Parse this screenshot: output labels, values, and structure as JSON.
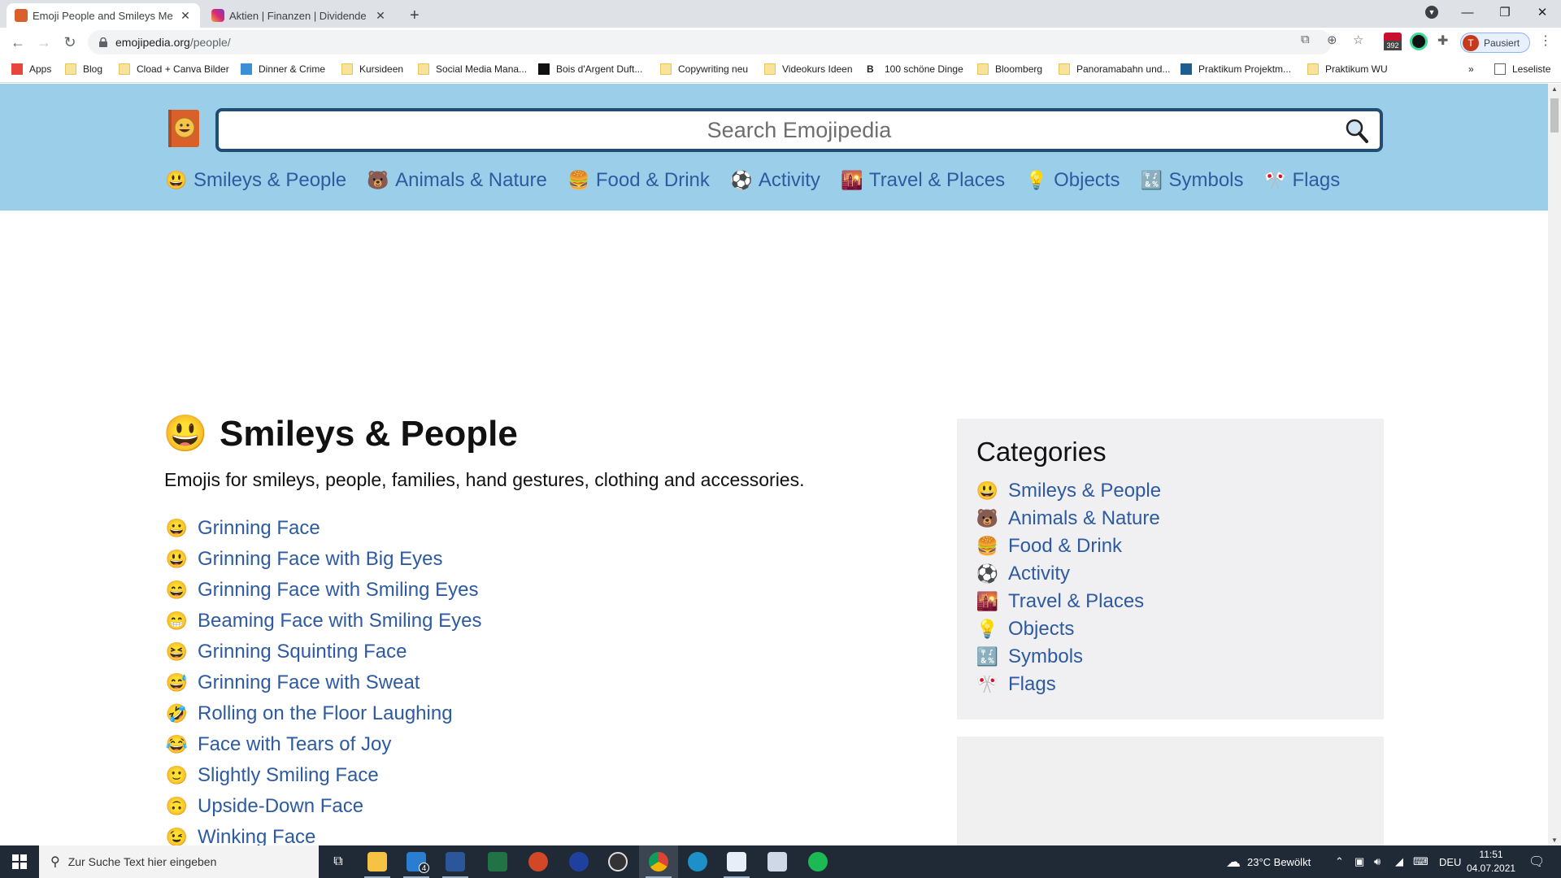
{
  "browser": {
    "tabs": [
      {
        "title": "Emoji People and Smileys Me",
        "active": true
      },
      {
        "title": "Aktien | Finanzen | Dividende (@",
        "active": false
      }
    ],
    "new_tab_label": "+",
    "url_host": "emojipedia.org",
    "url_path": "/people/",
    "profile_initial": "T",
    "profile_status": "Pausiert",
    "extension_badge": "392",
    "bookmarks": [
      {
        "label": "Apps",
        "icon": "apps-grid-icon"
      },
      {
        "label": "Blog",
        "icon": "folder-icon"
      },
      {
        "label": "Cload + Canva Bilder",
        "icon": "folder-icon"
      },
      {
        "label": "Dinner & Crime",
        "icon": "id-site-icon"
      },
      {
        "label": "Kursideen",
        "icon": "folder-icon"
      },
      {
        "label": "Social Media Mana...",
        "icon": "folder-icon"
      },
      {
        "label": "Bois d'Argent Duft...",
        "icon": "dior-site-icon"
      },
      {
        "label": "Copywriting neu",
        "icon": "folder-icon"
      },
      {
        "label": "Videokurs Ideen",
        "icon": "folder-icon"
      },
      {
        "label": "100 schöne Dinge",
        "icon": "b-site-icon"
      },
      {
        "label": "Bloomberg",
        "icon": "folder-icon"
      },
      {
        "label": "Panoramabahn und...",
        "icon": "folder-icon"
      },
      {
        "label": "Praktikum Projektm...",
        "icon": "j-site-icon"
      },
      {
        "label": "Praktikum WU",
        "icon": "folder-icon"
      }
    ],
    "bookmarks_overflow": "»",
    "reading_list": "Leseliste"
  },
  "site": {
    "search_placeholder": "Search Emojipedia",
    "nav": [
      {
        "label": "Smileys & People",
        "emoji": "😃"
      },
      {
        "label": "Animals & Nature",
        "emoji": "🐻"
      },
      {
        "label": "Food & Drink",
        "emoji": "🍔"
      },
      {
        "label": "Activity",
        "emoji": "⚽"
      },
      {
        "label": "Travel & Places",
        "emoji": "🌇"
      },
      {
        "label": "Objects",
        "emoji": "💡"
      },
      {
        "label": "Symbols",
        "emoji": "🔣"
      },
      {
        "label": "Flags",
        "emoji": "🎌"
      }
    ]
  },
  "main": {
    "title": "Smileys & People",
    "title_emoji": "😃",
    "intro": "Emojis for smileys, people, families, hand gestures, clothing and accessories.",
    "emojis": [
      {
        "name": "Grinning Face",
        "emoji": "😀"
      },
      {
        "name": "Grinning Face with Big Eyes",
        "emoji": "😃"
      },
      {
        "name": "Grinning Face with Smiling Eyes",
        "emoji": "😄"
      },
      {
        "name": "Beaming Face with Smiling Eyes",
        "emoji": "😁"
      },
      {
        "name": "Grinning Squinting Face",
        "emoji": "😆"
      },
      {
        "name": "Grinning Face with Sweat",
        "emoji": "😅"
      },
      {
        "name": "Rolling on the Floor Laughing",
        "emoji": "🤣"
      },
      {
        "name": "Face with Tears of Joy",
        "emoji": "😂"
      },
      {
        "name": "Slightly Smiling Face",
        "emoji": "🙂"
      },
      {
        "name": "Upside-Down Face",
        "emoji": "🙃"
      },
      {
        "name": "Winking Face",
        "emoji": "😉"
      }
    ]
  },
  "sidebar": {
    "title": "Categories",
    "items": [
      {
        "label": "Smileys & People"
      },
      {
        "label": "Animals & Nature"
      },
      {
        "label": "Food & Drink"
      },
      {
        "label": "Activity"
      },
      {
        "label": "Travel & Places"
      },
      {
        "label": "Objects"
      },
      {
        "label": "Symbols"
      },
      {
        "label": "Flags"
      }
    ]
  },
  "taskbar": {
    "search_placeholder": "Zur Suche Text hier eingeben",
    "mail_badge": "4",
    "weather": "23°C  Bewölkt",
    "language": "DEU",
    "time": "11:51",
    "date": "04.07.2021"
  },
  "colors": {
    "header_bg": "#9bcfe9",
    "link": "#2d5aa0",
    "search_border": "#1f4d74",
    "panel_bg": "#f0f0f2"
  }
}
